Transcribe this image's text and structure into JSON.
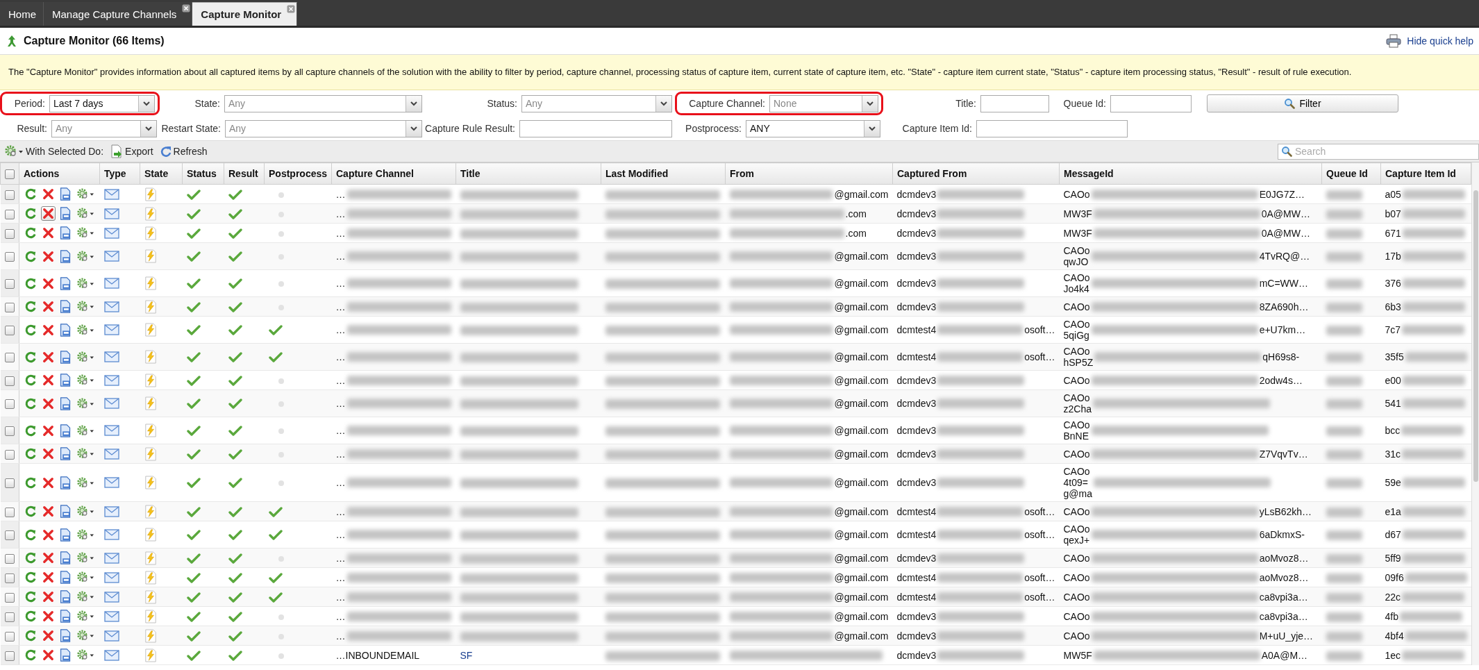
{
  "tabs": [
    {
      "label": "Home",
      "selected": false,
      "closable": false
    },
    {
      "label": "Manage Capture Channels",
      "selected": false,
      "closable": true
    },
    {
      "label": "Capture Monitor",
      "selected": true,
      "closable": true
    }
  ],
  "header": {
    "title": "Capture Monitor (66 Items)",
    "help_link": "Hide quick help"
  },
  "help_text": "The \"Capture Monitor\" provides information about all captured items by all capture channels of the solution with the ability to filter by period, capture channel, processing status of capture item, current state of capture item, etc. \"State\" - capture item current state, \"Status\" - capture item processing status, \"Result\" - result of rule execution.",
  "filters": [
    [
      {
        "kind": "select",
        "label": "Period:",
        "value": "Last 7 days",
        "dimmed": false,
        "highlighted": true
      },
      {
        "kind": "select",
        "label": "State:",
        "value": "Any",
        "dimmed": true,
        "highlighted": false
      },
      {
        "kind": "select",
        "label": "Status:",
        "value": "Any",
        "dimmed": true,
        "highlighted": false
      },
      {
        "kind": "select",
        "label": "Capture Channel:",
        "value": "None",
        "dimmed": true,
        "highlighted": true
      },
      {
        "kind": "input",
        "label": "Title:",
        "highlighted": false
      },
      {
        "kind": "input",
        "label": "Queue Id:",
        "highlighted": false
      },
      {
        "kind": "button",
        "label": "Filter"
      }
    ],
    [
      {
        "kind": "select",
        "label": "Result:",
        "value": "Any",
        "dimmed": true,
        "highlighted": false
      },
      {
        "kind": "select",
        "label": "Restart State:",
        "value": "Any",
        "dimmed": true,
        "highlighted": false
      },
      {
        "kind": "input",
        "label": "Capture Rule Result:",
        "highlighted": false
      },
      {
        "kind": "select",
        "label": "Postprocess:",
        "value": "ANY",
        "dimmed": false,
        "highlighted": false
      },
      {
        "kind": "input",
        "label": "Capture Item Id:",
        "highlighted": false
      }
    ]
  ],
  "toolbar": {
    "bulk_menu": "With Selected Do:",
    "export": "Export",
    "refresh": "Refresh",
    "search_placeholder": "Search"
  },
  "select_all_checked": false,
  "columns": [
    "Actions",
    "Type",
    "State",
    "Status",
    "Result",
    "Postprocess",
    "Capture Channel",
    "Title",
    "Last Modified",
    "From",
    "Captured From",
    "MessageId",
    "Queue Id",
    "Capture Item Id"
  ],
  "rows": [
    {
      "checked": false,
      "delete_hovered": false,
      "postprocessed": false,
      "channel": "…",
      "from_end": "@gmail.com",
      "captured_start": "dcmdev3",
      "message_start": [
        "CAOo"
      ],
      "message_end": "E0JG7Z…",
      "item_id_start": "a05"
    },
    {
      "checked": false,
      "delete_hovered": true,
      "postprocessed": false,
      "channel": "…",
      "from_end": ".com",
      "captured_start": "dcmdev3",
      "message_start": [
        "MW3F"
      ],
      "message_end": "0A@MW…",
      "item_id_start": "b07"
    },
    {
      "checked": false,
      "delete_hovered": false,
      "postprocessed": false,
      "channel": "…",
      "from_end": ".com",
      "captured_start": "dcmdev3",
      "message_start": [
        "MW3F"
      ],
      "message_end": "0A@MW…",
      "item_id_start": "671"
    },
    {
      "checked": false,
      "delete_hovered": false,
      "postprocessed": false,
      "channel": "…",
      "from_end": "@gmail.com",
      "captured_start": "dcmdev3",
      "message_start": [
        "CAOo",
        "qwJO"
      ],
      "message_end": "4TvRQ@…",
      "item_id_start": "17b"
    },
    {
      "checked": false,
      "delete_hovered": false,
      "postprocessed": false,
      "channel": "…",
      "from_end": "@gmail.com",
      "captured_start": "dcmdev3",
      "message_start": [
        "CAOo",
        "Jo4k4"
      ],
      "message_end": "mC=WW…",
      "item_id_start": "376"
    },
    {
      "checked": false,
      "delete_hovered": false,
      "postprocessed": false,
      "channel": "…",
      "from_end": "@gmail.com",
      "captured_start": "dcmdev3",
      "message_start": [
        "CAOo"
      ],
      "message_end": "8ZA690h…",
      "item_id_start": "6b3"
    },
    {
      "checked": false,
      "delete_hovered": false,
      "postprocessed": true,
      "channel": "…",
      "from_end": "@gmail.com",
      "captured_start": "dcmtest4",
      "captured_end": "osoft…",
      "message_start": [
        "CAOo",
        "5qiGg"
      ],
      "message_end": "e+U7km…",
      "item_id_start": "7c7"
    },
    {
      "checked": false,
      "delete_hovered": false,
      "postprocessed": true,
      "channel": "…",
      "from_end": "@gmail.com",
      "captured_start": "dcmtest4",
      "captured_end": "osoft…",
      "message_start": [
        "CAOo",
        "hSP5Z"
      ],
      "message_end": "qH69s8-",
      "item_id_start": "35f5"
    },
    {
      "checked": false,
      "delete_hovered": false,
      "postprocessed": false,
      "channel": "…",
      "from_end": "@gmail.com",
      "captured_start": "dcmdev3",
      "message_start": [
        "CAOo"
      ],
      "message_end": "2odw4s…",
      "item_id_start": "e00"
    },
    {
      "checked": false,
      "delete_hovered": false,
      "postprocessed": false,
      "channel": "…",
      "from_end": "@gmail.com",
      "captured_start": "dcmdev3",
      "message_start": [
        "CAOo",
        "z2Cha"
      ],
      "item_id_start": "541"
    },
    {
      "checked": false,
      "delete_hovered": false,
      "postprocessed": false,
      "channel": "…",
      "from_end": "@gmail.com",
      "captured_start": "dcmdev3",
      "message_start": [
        "CAOo",
        "BnNE"
      ],
      "item_id_start": "bcc"
    },
    {
      "checked": false,
      "delete_hovered": false,
      "postprocessed": false,
      "channel": "…",
      "from_end": "@gmail.com",
      "captured_start": "dcmdev3",
      "message_start": [
        "CAOo"
      ],
      "message_end": "Z7VqvTv…",
      "item_id_start": "31c"
    },
    {
      "checked": false,
      "delete_hovered": false,
      "postprocessed": false,
      "channel": "…",
      "from_end": "@gmail.com",
      "captured_start": "dcmdev3",
      "message_start": [
        "CAOo",
        "4t09=",
        "g@ma"
      ],
      "item_id_start": "59e"
    },
    {
      "checked": false,
      "delete_hovered": false,
      "postprocessed": true,
      "channel": "…",
      "from_end": "@gmail.com",
      "captured_start": "dcmtest4",
      "captured_end": "osoft…",
      "message_start": [
        "CAOo"
      ],
      "message_end": "yLsB62kh…",
      "item_id_start": "e1a"
    },
    {
      "checked": false,
      "delete_hovered": false,
      "postprocessed": true,
      "channel": "…",
      "from_end": "@gmail.com",
      "captured_start": "dcmtest4",
      "captured_end": "osoft…",
      "message_start": [
        "CAOo",
        "qexJ+"
      ],
      "message_end": "6aDkmxS-",
      "item_id_start": "d67"
    },
    {
      "checked": false,
      "delete_hovered": false,
      "postprocessed": false,
      "channel": "…",
      "from_end": "@gmail.com",
      "captured_start": "dcmdev3",
      "message_start": [
        "CAOo"
      ],
      "message_end": "aoMvoz8…",
      "item_id_start": "5ff9"
    },
    {
      "checked": false,
      "delete_hovered": false,
      "postprocessed": true,
      "channel": "…",
      "from_end": "@gmail.com",
      "captured_start": "dcmtest4",
      "captured_end": "osoft…",
      "message_start": [
        "CAOo"
      ],
      "message_end": "aoMvoz8…",
      "item_id_start": "09f6"
    },
    {
      "checked": false,
      "delete_hovered": false,
      "postprocessed": true,
      "channel": "…",
      "from_end": "@gmail.com",
      "captured_start": "dcmtest4",
      "captured_end": "osoft…",
      "message_start": [
        "CAOo"
      ],
      "message_end": "ca8vpi3a…",
      "item_id_start": "22c"
    },
    {
      "checked": false,
      "delete_hovered": false,
      "postprocessed": false,
      "channel": "…",
      "from_end": "@gmail.com",
      "captured_start": "dcmdev3",
      "message_start": [
        "CAOo"
      ],
      "message_end": "ca8vpi3a…",
      "item_id_start": "4fb"
    },
    {
      "checked": false,
      "delete_hovered": false,
      "postprocessed": false,
      "channel": "…",
      "from_end": "@gmail.com",
      "captured_start": "dcmdev3",
      "message_start": [
        "CAOo"
      ],
      "message_end": "M+uU_yje…",
      "item_id_start": "4bf4"
    },
    {
      "checked": false,
      "delete_hovered": false,
      "postprocessed": false,
      "channel": "…INBOUNDEMAIL",
      "title": "SF",
      "captured_start": "dcmdev3",
      "message_start": [
        "MW5F"
      ],
      "message_end": "A0A@M…",
      "item_id_start": "1ec"
    }
  ]
}
